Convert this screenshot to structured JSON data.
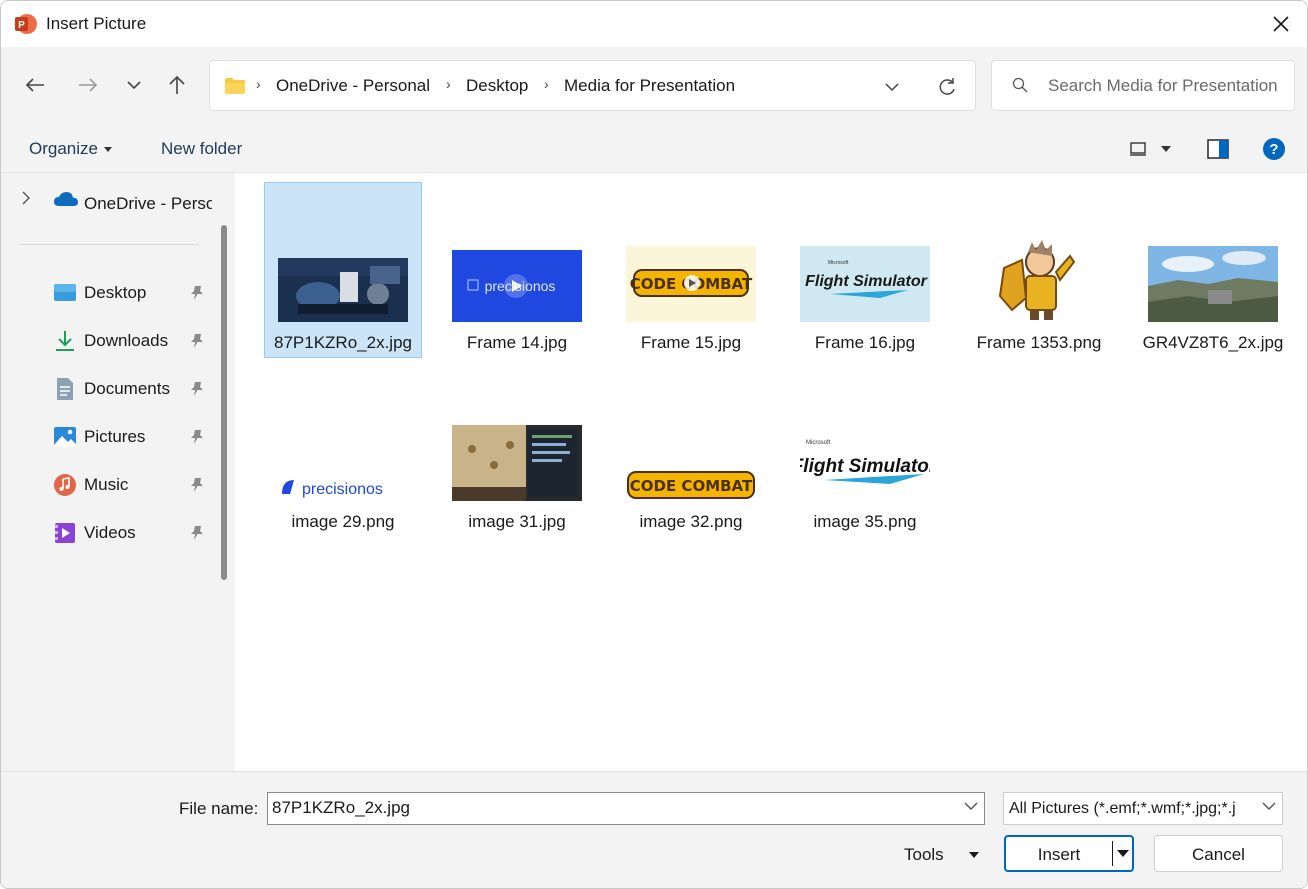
{
  "window": {
    "title": "Insert Picture"
  },
  "icons": {
    "app": "powerpoint-icon",
    "close": "close-icon"
  },
  "nav": {
    "back": "back-arrow-icon",
    "forward": "forward-arrow-icon",
    "recent": "chevron-down-icon",
    "up": "up-arrow-icon"
  },
  "address": {
    "crumbs": [
      "OneDrive - Personal",
      "Desktop",
      "Media for Presentation"
    ]
  },
  "search": {
    "placeholder": "Search Media for Presentation"
  },
  "commands": {
    "organize": "Organize",
    "new_folder": "New folder"
  },
  "sidebar": {
    "root": {
      "label": "OneDrive - Personal",
      "icon": "cloud-icon"
    },
    "quick_access": [
      {
        "label": "Desktop",
        "icon": "desktop-icon",
        "pinned": true
      },
      {
        "label": "Downloads",
        "icon": "download-icon",
        "pinned": true
      },
      {
        "label": "Documents",
        "icon": "documents-icon",
        "pinned": true
      },
      {
        "label": "Pictures",
        "icon": "pictures-icon",
        "pinned": true
      },
      {
        "label": "Music",
        "icon": "music-icon",
        "pinned": true
      },
      {
        "label": "Videos",
        "icon": "videos-icon",
        "pinned": true
      }
    ]
  },
  "files": [
    {
      "name": "87P1KZRo_2x.jpg",
      "selected": true
    },
    {
      "name": "Frame 14.jpg",
      "thumb_text": "precisionos"
    },
    {
      "name": "Frame 15.jpg",
      "thumb_text": "CODE COMBAT"
    },
    {
      "name": "Frame 16.jpg",
      "thumb_text": "Flight Simulator",
      "thumb_small": "Microsoft"
    },
    {
      "name": "Frame 1353.png"
    },
    {
      "name": "GR4VZ8T6_2x.jpg"
    },
    {
      "name": "image 29.png",
      "thumb_text": "precisionos"
    },
    {
      "name": "image 31.jpg"
    },
    {
      "name": "image 32.png",
      "thumb_text": "CODE COMBAT"
    },
    {
      "name": "image 35.png",
      "thumb_text": "Flight Simulator",
      "thumb_small": "Microsoft"
    }
  ],
  "bottom": {
    "file_name_label": "File name:",
    "file_name_value": "87P1KZRo_2x.jpg",
    "file_type": "All Pictures (*.emf;*.wmf;*.jpg;*.j",
    "tools": "Tools",
    "insert": "Insert",
    "cancel": "Cancel"
  },
  "colors": {
    "accent": "#0067c0",
    "selection": "#cce4f7",
    "chrome": "#f3f3f3"
  }
}
